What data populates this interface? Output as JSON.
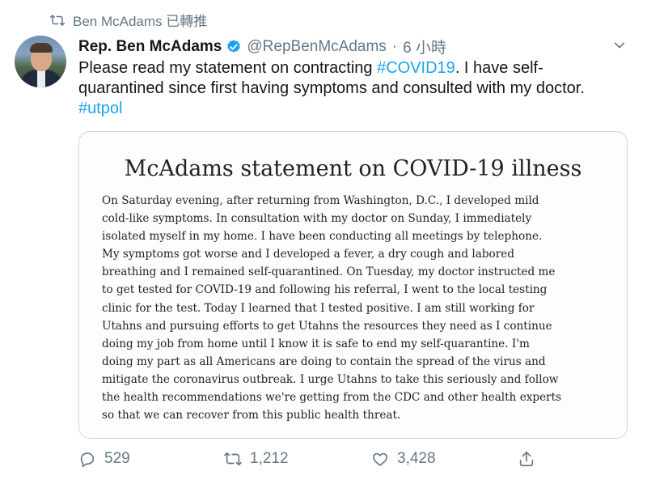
{
  "retweet": {
    "label": "Ben McAdams 已轉推"
  },
  "tweet": {
    "name": "Rep. Ben McAdams",
    "handle": "@RepBenMcAdams",
    "separator": "·",
    "time": "6 小時",
    "text_part1": "Please read my statement on contracting ",
    "hashtag1": "#COVID19",
    "text_part2": ". I have self-quarantined since first having symptoms and consulted with my doctor.",
    "hashtag2": "#utpol"
  },
  "card": {
    "title": "McAdams statement on COVID-19 illness",
    "lines": [
      "On Saturday evening, after returning from Washington, D.C., I developed mild",
      "cold-like symptoms. In consultation with my doctor on Sunday, I immediately",
      "isolated myself in my home. I have been conducting all meetings by telephone.",
      "My symptoms got worse and I developed a fever, a dry cough and labored",
      "breathing and I remained self-quarantined. On Tuesday, my doctor instructed me",
      "to get tested for COVID-19 and following his referral, I went to the local testing",
      "clinic for the test. Today I learned that I tested positive.  I am still working for",
      "Utahns and pursuing efforts to get Utahns the resources they need as I continue",
      "doing my job from home until I know it is safe to end my self-quarantine. I'm",
      "doing my part as all Americans are doing to contain the spread of the virus and",
      "mitigate the coronavirus outbreak. I urge Utahns to take this seriously and follow",
      "the health recommendations we're getting from the CDC and other health experts",
      "so that we can recover from this public health threat."
    ]
  },
  "actions": {
    "replies": "529",
    "retweets": "1,212",
    "likes": "3,428"
  },
  "colors": {
    "link": "#1da1f2",
    "secondary": "#657786",
    "verified": "#1da1f2"
  },
  "icons": [
    "retweet-icon",
    "verified-badge-icon",
    "chevron-down-icon",
    "reply-icon",
    "retweet-icon",
    "like-icon",
    "share-icon"
  ]
}
